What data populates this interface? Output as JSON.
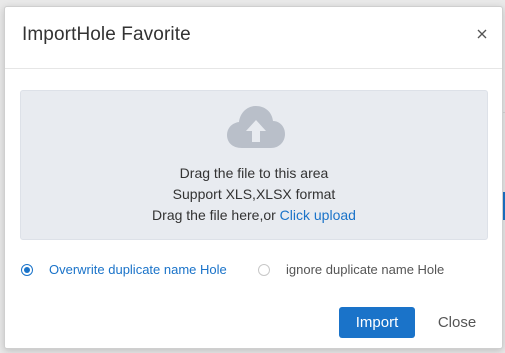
{
  "dialog": {
    "title": "ImportHole Favorite",
    "close_icon": "close-icon"
  },
  "upload": {
    "icon": "cloud-upload-icon",
    "line1": "Drag the file to this area",
    "line2": "Support XLS,XLSX format",
    "line3_prefix": "Drag the file here,or ",
    "line3_link": "Click upload"
  },
  "options": [
    {
      "label": "Overwrite duplicate name Hole",
      "checked": true
    },
    {
      "label": "ignore duplicate name Hole",
      "checked": false
    }
  ],
  "buttons": {
    "import_label": "Import",
    "close_label": "Close"
  },
  "colors": {
    "accent": "#1a73c9",
    "upload_bg": "#e8ebf0",
    "icon": "#b9bfc9"
  }
}
